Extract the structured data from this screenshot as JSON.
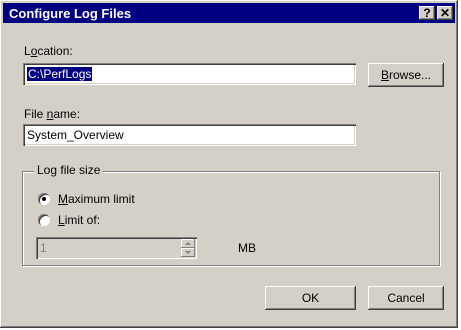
{
  "window": {
    "title": "Configure Log Files",
    "help_button": "?",
    "close_button": "✕"
  },
  "location": {
    "label_pre": "L",
    "label_u": "o",
    "label_post": "cation:",
    "value": "C:\\PerfLogs"
  },
  "browse": {
    "label_u": "B",
    "label_post": "rowse..."
  },
  "filename": {
    "label_pre": "File ",
    "label_u": "n",
    "label_post": "ame:",
    "value": "System_Overview"
  },
  "log_size": {
    "group_title": "Log file size",
    "max_limit": {
      "label_u": "M",
      "label_post": "aximum limit",
      "selected": true
    },
    "limit_of": {
      "label_u": "L",
      "label_post": "imit of:",
      "selected": false
    },
    "value": "1",
    "unit": "MB"
  },
  "buttons": {
    "ok": "OK",
    "cancel": "Cancel"
  }
}
